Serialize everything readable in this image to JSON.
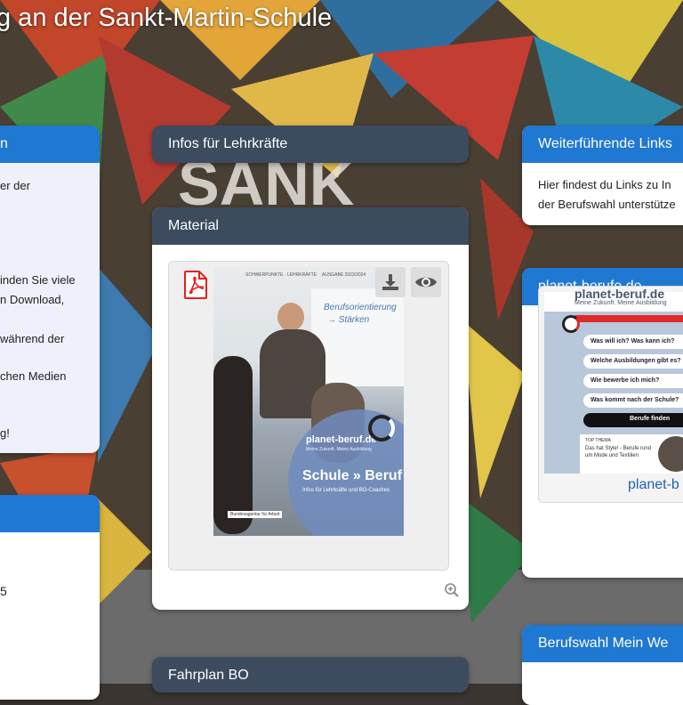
{
  "page": {
    "title": "g an der Sankt-Martin-Schule"
  },
  "left_card": {
    "title_tail": "n",
    "lines": [
      "er der",
      "inden Sie viele",
      "n Download,",
      "während der",
      "chen Medien",
      "g!"
    ]
  },
  "left_card_2": {
    "value": "5"
  },
  "infos_lehrkraefte": {
    "title": "Infos für Lehrkräfte"
  },
  "material": {
    "title": "Material",
    "cover": {
      "header_left": "SCHWERPUNKTE · LEHRKRÄFTE",
      "header_right": "AUSGABE 2023/2024",
      "handwriting_1": "Berufsorientierung",
      "handwriting_2": "→ Stärken",
      "brand": "planet-beruf.de",
      "brand_sub": "Meine Zukunft. Meine Ausbildung",
      "headline": "Schule » Beruf",
      "subline": "Infos für Lehrkräfte und BO-Coaches",
      "footer": "Bundesagentur für Arbeit"
    }
  },
  "fahrplan": {
    "title": "Fahrplan BO"
  },
  "weiterfuehrende": {
    "title": "Weiterführende Links",
    "text_1": "Hier findest du Links zu In",
    "text_2": "der Berufswahl unterstütze"
  },
  "planet_berufe": {
    "title": "planet-berufe.de",
    "shot": {
      "brand": "planet-beruf.de",
      "tagline": "Meine Zukunft. Meine Ausbildung",
      "questions": [
        "Was will ich? Was kann ich?",
        "Welche Ausbildungen gibt es?",
        "Wie bewerbe ich mich?",
        "Was kommt nach der Schule?"
      ],
      "button": "Berufe finden",
      "tip_label": "TOP THEMA",
      "tip_text": "Das hat Style! - Berufe rund um Mode und Textilien"
    },
    "caption": "planet-b"
  },
  "berufswahl": {
    "title": "Berufswahl Mein We"
  },
  "icons": {
    "pdf": "pdf-icon",
    "download": "download-icon",
    "preview": "eye-icon",
    "zoom": "zoom-in-icon"
  },
  "colors": {
    "blue": "#1f78d1",
    "dark": "#3c4b5e",
    "pdf_red": "#e3211c"
  }
}
